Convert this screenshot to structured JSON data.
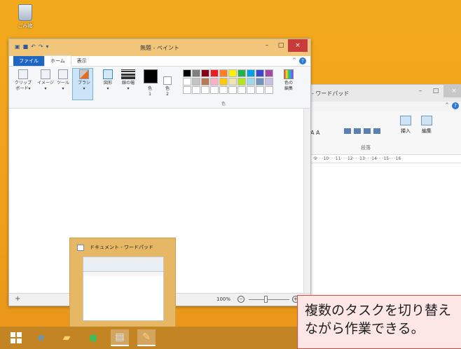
{
  "desktop": {
    "recycle_bin_label": "ごみ箱"
  },
  "wordpad": {
    "title": "- ワードパッド",
    "minimize": "–",
    "maximize": "□",
    "close": "×",
    "collapse": "^",
    "help": "?",
    "font_buttons": "A  A",
    "paragraph_group": "段落",
    "insert_label": "挿入",
    "edit_label": "編集",
    "ruler": "·8· · ·9· · ·10· · ·11· · ·12· · ·13· · ·14· · ·15· · ·16"
  },
  "paint": {
    "title": "無題 - ペイント",
    "minimize": "–",
    "maximize": "□",
    "close": "×",
    "collapse": "^",
    "help": "?",
    "tabs": {
      "file": "ファイル",
      "home": "ホーム",
      "view": "表示"
    },
    "tools": {
      "clipboard": "クリップ\nボード▾",
      "image": "イメージ\n▾",
      "tools": "ツール\n▾",
      "brush": "ブラシ\n▾",
      "shapes": "図形\n▾",
      "width": "線の幅\n▾",
      "color1": "色\n1",
      "color2": "色\n2",
      "edit_colors": "色の\n編集"
    },
    "color_group": "色",
    "palette": [
      "#000000",
      "#7f7f7f",
      "#880015",
      "#ed1c24",
      "#ff7f27",
      "#fff200",
      "#22b14c",
      "#00a2e8",
      "#3f48cc",
      "#a349a4",
      "#ffffff",
      "#c3c3c3",
      "#b97a57",
      "#ffaec9",
      "#ffc90e",
      "#efe4b0",
      "#b5e61d",
      "#99d9ea",
      "#7092be",
      "#c8bfe7",
      "#ffffff",
      "#ffffff",
      "#ffffff",
      "#ffffff",
      "#ffffff",
      "#ffffff",
      "#ffffff",
      "#ffffff",
      "#ffffff",
      "#ffffff"
    ],
    "status": {
      "add": "+",
      "zoom": "100%",
      "zoom_out": "–",
      "zoom_in": "+"
    }
  },
  "preview": {
    "title": "ドキュメント - ワードパッド"
  },
  "callout": {
    "line1": "複数のタスクを切り替え",
    "line2": "ながら作業できる。"
  }
}
